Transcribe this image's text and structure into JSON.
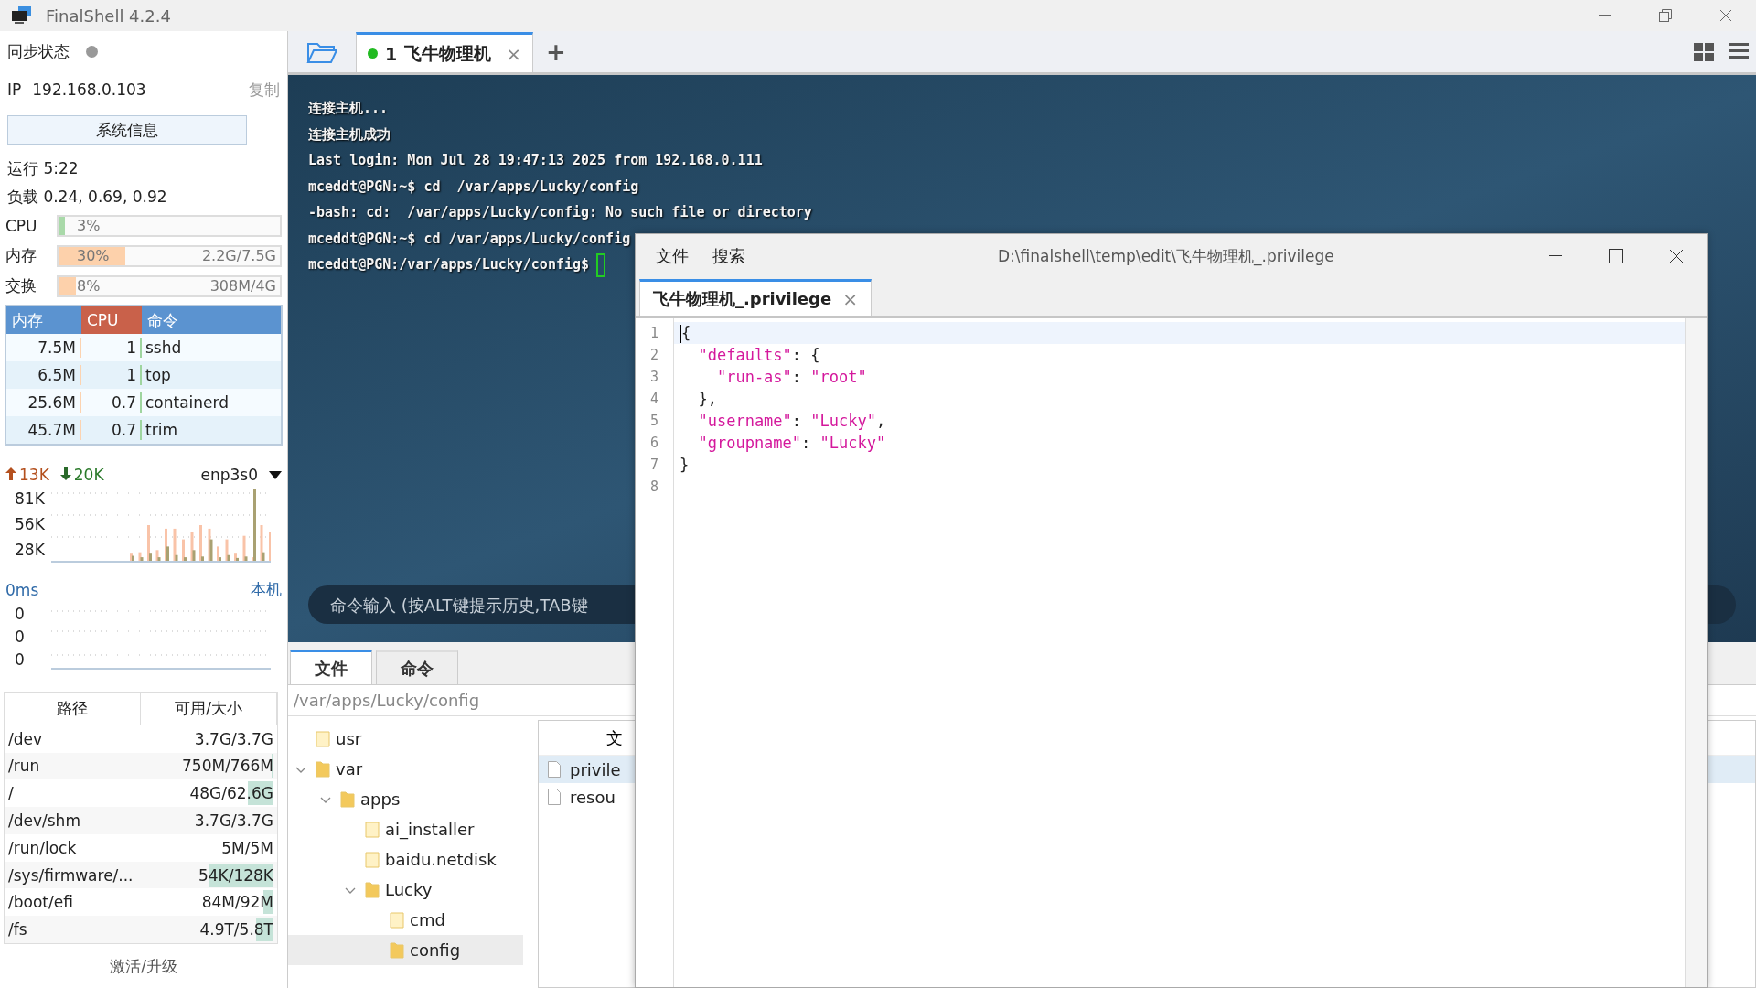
{
  "window": {
    "title": "FinalShell 4.2.4"
  },
  "sidebar": {
    "sync": {
      "label": "同步状态",
      "online": false
    },
    "ip": {
      "label": "IP",
      "value": "192.168.0.103",
      "copy": "复制"
    },
    "sysinfo_button": "系统信息",
    "uptime": "运行 5:22",
    "load": "负载 0.24, 0.69, 0.92",
    "meters": [
      {
        "label": "CPU",
        "percent": "3%",
        "level": 0.03,
        "color": "#a9d9a9"
      },
      {
        "label": "内存",
        "percent": "30%",
        "detail": "2.2G/7.5G",
        "level": 0.3,
        "color": "#fdd1ab"
      },
      {
        "label": "交换",
        "percent": "8%",
        "detail": "308M/4G",
        "level": 0.08,
        "color": "#fdd1ab"
      }
    ],
    "processes": {
      "columns": [
        {
          "label": "内存",
          "selected": false
        },
        {
          "label": "CPU",
          "selected": true
        },
        {
          "label": "命令",
          "selected": false
        }
      ],
      "rows": [
        {
          "memory": "7.5M",
          "cpu": "1",
          "command": "sshd"
        },
        {
          "memory": "6.5M",
          "cpu": "1",
          "command": "top"
        },
        {
          "memory": "25.6M",
          "cpu": "0.7",
          "command": "containerd"
        },
        {
          "memory": "45.7M",
          "cpu": "0.7",
          "command": "trim"
        }
      ]
    },
    "network": {
      "up": "13K",
      "down": "20K",
      "interface": "enp3s0",
      "ticks": [
        "81K",
        "56K",
        "28K"
      ]
    },
    "ping": {
      "latency": "0ms",
      "host": "本机",
      "ticks": [
        "0",
        "0",
        "0"
      ]
    },
    "disks": {
      "columns": [
        "路径",
        "可用/大小"
      ],
      "rows": [
        {
          "path": "/dev",
          "usage": "3.7G/3.7G"
        },
        {
          "path": "/run",
          "usage": "750M/766M",
          "level": 0.02
        },
        {
          "path": "/",
          "usage": "48G/62.6G",
          "level": 0.23
        },
        {
          "path": "/dev/shm",
          "usage": "3.7G/3.7G"
        },
        {
          "path": "/run/lock",
          "usage": "5M/5M"
        },
        {
          "path": "/sys/firmware/...",
          "usage": "54K/128K",
          "level": 0.58
        },
        {
          "path": "/boot/efi",
          "usage": "84M/92M",
          "level": 0.09
        },
        {
          "path": "/fs",
          "usage": "4.9T/5.8T",
          "level": 0.16
        }
      ]
    },
    "upgrade": "激活/升级"
  },
  "session_tabs": [
    {
      "number": "1",
      "label": "飞牛物理机",
      "connected": true,
      "selected": true,
      "close": "×"
    }
  ],
  "add_tab": "+",
  "terminal": {
    "lines": [
      "连接主机...",
      "连接主机成功",
      "Last login: Mon Jul 28 19:47:13 2025 from 192.168.0.111",
      "mceddt@PGN:~$ cd  /var/apps/Lucky/config",
      "-bash: cd:  /var/apps/Lucky/config: No such file or directory",
      "mceddt@PGN:~$ cd /var/apps/Lucky/config"
    ],
    "prompt": "mceddt@PGN:/var/apps/Lucky/config$",
    "command_placeholder": "命令输入 (按ALT键提示历史,TAB键"
  },
  "bottom_tabs": [
    {
      "label": "文件",
      "selected": true
    },
    {
      "label": "命令",
      "selected": false
    }
  ],
  "file_path": "/var/apps/Lucky/config",
  "tree": [
    {
      "name": "usr",
      "selected": false
    },
    {
      "name": "var",
      "selected": false,
      "expanded": true,
      "children": [
        {
          "name": "apps",
          "selected": false,
          "expanded": true,
          "children": [
            {
              "name": "ai_installer",
              "selected": false
            },
            {
              "name": "baidu.netdisk",
              "selected": false
            },
            {
              "name": "Lucky",
              "selected": false,
              "expanded": true,
              "children": [
                {
                  "name": "cmd",
                  "selected": false
                },
                {
                  "name": "config",
                  "selected": true
                }
              ]
            }
          ]
        }
      ]
    }
  ],
  "file_list": {
    "column": "文",
    "rows": [
      {
        "name": "privile",
        "selected": true
      },
      {
        "name": "resou",
        "selected": false
      }
    ]
  },
  "editor": {
    "menu": [
      "文件",
      "搜索"
    ],
    "title": "D:\\finalshell\\temp\\edit\\飞牛物理机_.privilege",
    "tabs": [
      {
        "label": "飞牛物理机_.privilege",
        "selected": true,
        "close": "×"
      }
    ],
    "lines": [
      {
        "number": "1",
        "current": true,
        "segments": [
          {
            "kind": "punct",
            "text": "{"
          }
        ]
      },
      {
        "number": "2",
        "current": false,
        "segments": [
          {
            "kind": "string",
            "text": "  \"defaults\""
          },
          {
            "kind": "punct",
            "text": ": {"
          }
        ]
      },
      {
        "number": "3",
        "current": false,
        "segments": [
          {
            "kind": "string",
            "text": "    \"run-as\""
          },
          {
            "kind": "punct",
            "text": ": "
          },
          {
            "kind": "string",
            "text": "\"root\""
          }
        ]
      },
      {
        "number": "4",
        "current": false,
        "segments": [
          {
            "kind": "punct",
            "text": "  },"
          }
        ]
      },
      {
        "number": "5",
        "current": false,
        "segments": [
          {
            "kind": "string",
            "text": "  \"username\""
          },
          {
            "kind": "punct",
            "text": ": "
          },
          {
            "kind": "string",
            "text": "\"Lucky\""
          },
          {
            "kind": "punct",
            "text": ","
          }
        ]
      },
      {
        "number": "6",
        "current": false,
        "segments": [
          {
            "kind": "string",
            "text": "  \"groupname\""
          },
          {
            "kind": "punct",
            "text": ": "
          },
          {
            "kind": "string",
            "text": "\"Lucky\""
          }
        ]
      },
      {
        "number": "7",
        "current": false,
        "segments": [
          {
            "kind": "punct",
            "text": "}"
          }
        ]
      },
      {
        "number": "8",
        "current": false
      }
    ]
  }
}
